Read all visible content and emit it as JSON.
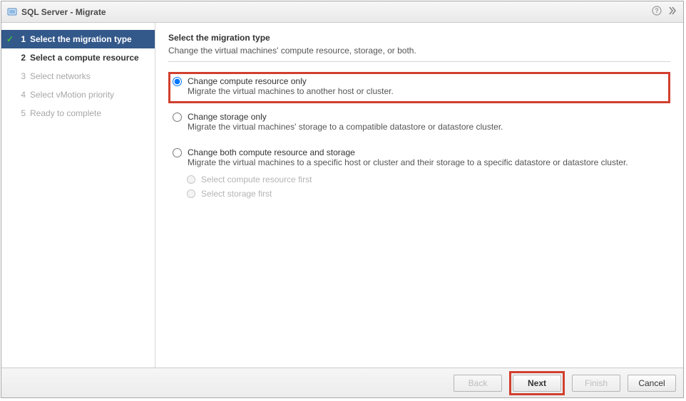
{
  "titlebar": {
    "title": "SQL Server - Migrate"
  },
  "sidebar": {
    "steps": [
      {
        "num": "1",
        "label": "Select the migration type",
        "state": "selected",
        "done": true
      },
      {
        "num": "2",
        "label": "Select a compute resource",
        "state": "next",
        "done": false
      },
      {
        "num": "3",
        "label": "Select networks",
        "state": "disabled",
        "done": false
      },
      {
        "num": "4",
        "label": "Select vMotion priority",
        "state": "disabled",
        "done": false
      },
      {
        "num": "5",
        "label": "Ready to complete",
        "state": "disabled",
        "done": false
      }
    ]
  },
  "main": {
    "heading": "Select the migration type",
    "subtitle": "Change the virtual machines' compute resource, storage, or both.",
    "options": [
      {
        "title": "Change compute resource only",
        "desc": "Migrate the virtual machines to another host or cluster.",
        "selected": true,
        "highlight": true
      },
      {
        "title": "Change storage only",
        "desc": "Migrate the virtual machines' storage to a compatible datastore or datastore cluster.",
        "selected": false,
        "highlight": false
      },
      {
        "title": "Change both compute resource and storage",
        "desc": "Migrate the virtual machines to a specific host or cluster and their storage to a specific datastore or datastore cluster.",
        "selected": false,
        "highlight": false,
        "suboptions": [
          "Select compute resource first",
          "Select storage first"
        ]
      }
    ]
  },
  "footer": {
    "back": "Back",
    "next": "Next",
    "finish": "Finish",
    "cancel": "Cancel"
  }
}
